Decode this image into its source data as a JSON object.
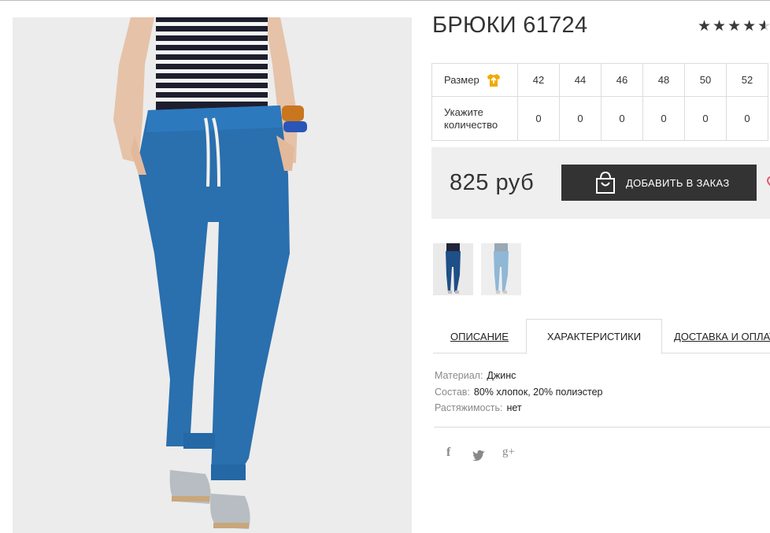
{
  "product": {
    "title": "БРЮКИ 61724",
    "rating": 4.5
  },
  "size_table": {
    "size_label": "Размер",
    "quantity_label_line1": "Укажите",
    "quantity_label_line2": "количество",
    "sizes": [
      "42",
      "44",
      "46",
      "48",
      "50",
      "52"
    ],
    "quantities": [
      "0",
      "0",
      "0",
      "0",
      "0",
      "0"
    ]
  },
  "purchase": {
    "price": "825 руб",
    "add_button_label": "ДОБАВИТЬ В ЗАКАЗ"
  },
  "tabs": {
    "description": "ОПИСАНИЕ",
    "characteristics": "ХАРАКТЕРИСТИКИ",
    "delivery": "ДОСТАВКА И ОПЛАТА"
  },
  "characteristics": [
    {
      "key": "Материал:",
      "value": "Джинс"
    },
    {
      "key": "Состав:",
      "value": "80% хлопок, 20% полиэстер"
    },
    {
      "key": "Растяжимость:",
      "value": "нет"
    }
  ],
  "social": {
    "facebook": "f",
    "twitter": "twitter-icon",
    "googleplus": "g+"
  },
  "colors": {
    "button_bg": "#333333",
    "size_icon": "#f2a900",
    "jeans_dark": "#1e5f9e",
    "jeans_light": "#8fb7d6"
  }
}
